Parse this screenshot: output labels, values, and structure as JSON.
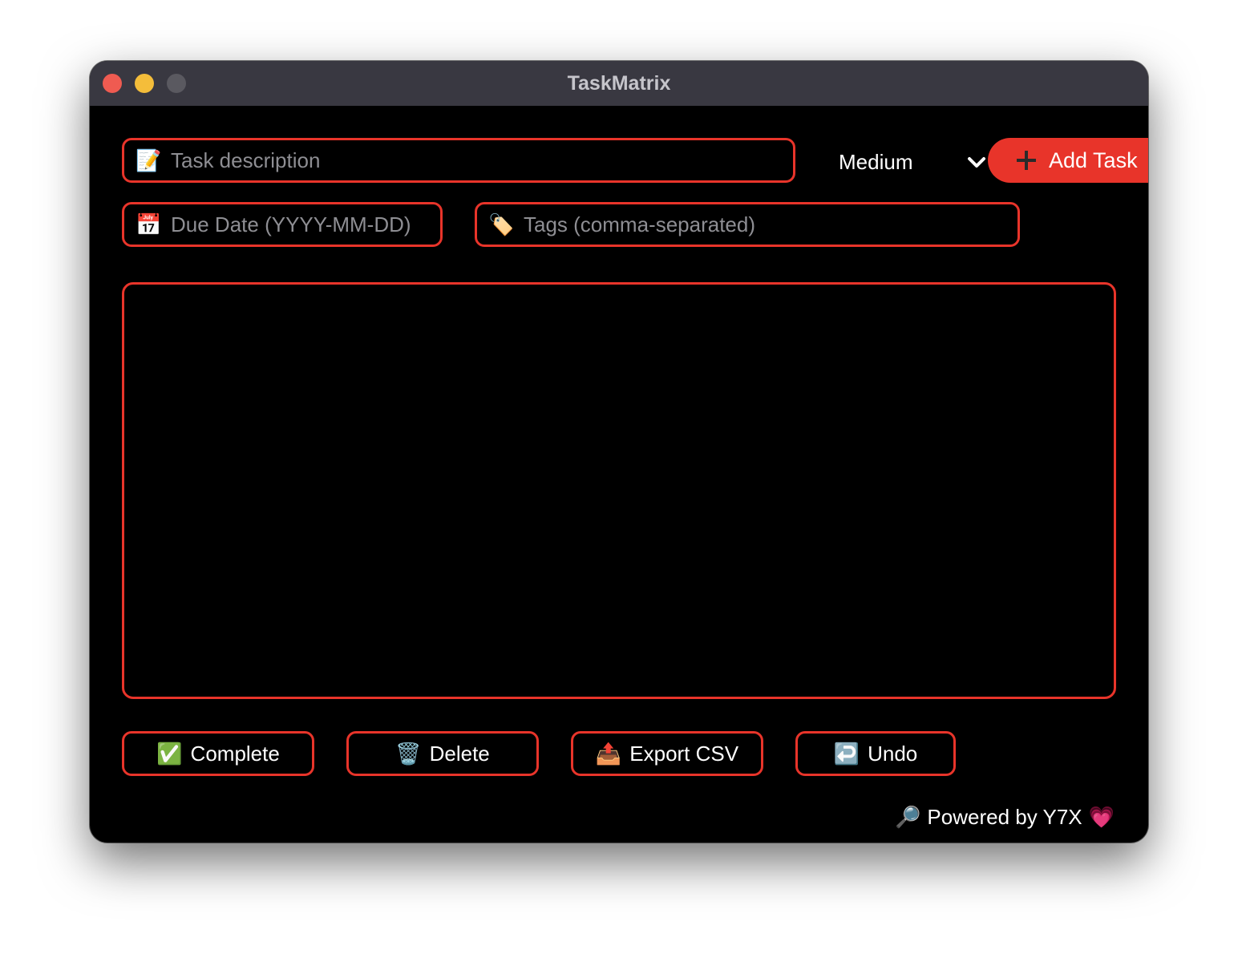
{
  "window": {
    "title": "TaskMatrix"
  },
  "form": {
    "description": {
      "icon": "📝",
      "placeholder": "Task description",
      "value": ""
    },
    "due_date": {
      "icon": "📅",
      "placeholder": "Due Date (YYYY-MM-DD)",
      "value": ""
    },
    "tags": {
      "icon": "🏷️",
      "placeholder": "Tags (comma-separated)",
      "value": ""
    },
    "priority": {
      "selected": "Medium"
    },
    "add_button": {
      "label": "Add Task"
    }
  },
  "task_list": {
    "items": []
  },
  "actions": {
    "complete": {
      "icon": "✅",
      "label": "Complete"
    },
    "delete": {
      "icon": "🗑️",
      "label": "Delete"
    },
    "export": {
      "icon": "📤",
      "label": "Export CSV"
    },
    "undo": {
      "icon": "↩️",
      "label": "Undo"
    }
  },
  "footer": {
    "icon": "🔎",
    "text": "Powered by Y7X",
    "heart": "💗"
  },
  "colors": {
    "accent": "#e8342a",
    "background": "#000000",
    "titlebar": "#393841"
  }
}
